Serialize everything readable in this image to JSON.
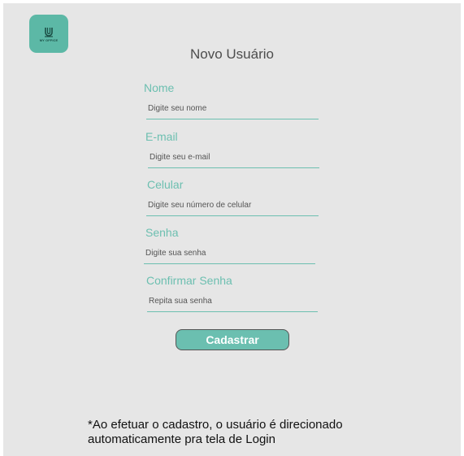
{
  "logo": {
    "text": "MY OFFICE"
  },
  "title": "Novo Usuário",
  "fields": [
    {
      "label": "Nome",
      "placeholder": "Digite seu nome"
    },
    {
      "label": "E-mail",
      "placeholder": "Digite seu e-mail"
    },
    {
      "label": "Celular",
      "placeholder": "Digite seu número de celular"
    },
    {
      "label": "Senha",
      "placeholder": "Digite sua senha"
    },
    {
      "label": "Confirmar Senha",
      "placeholder": "Repita sua senha"
    }
  ],
  "submit_label": "Cadastrar",
  "note": {
    "line1": "*Ao efetuar o cadastro, o usuário é direcionado",
    "line2": "automaticamente pra tela de Login"
  },
  "colors": {
    "accent": "#6cbfb0",
    "logo_bg": "#5cb8a6",
    "background": "#e6e6e6"
  }
}
